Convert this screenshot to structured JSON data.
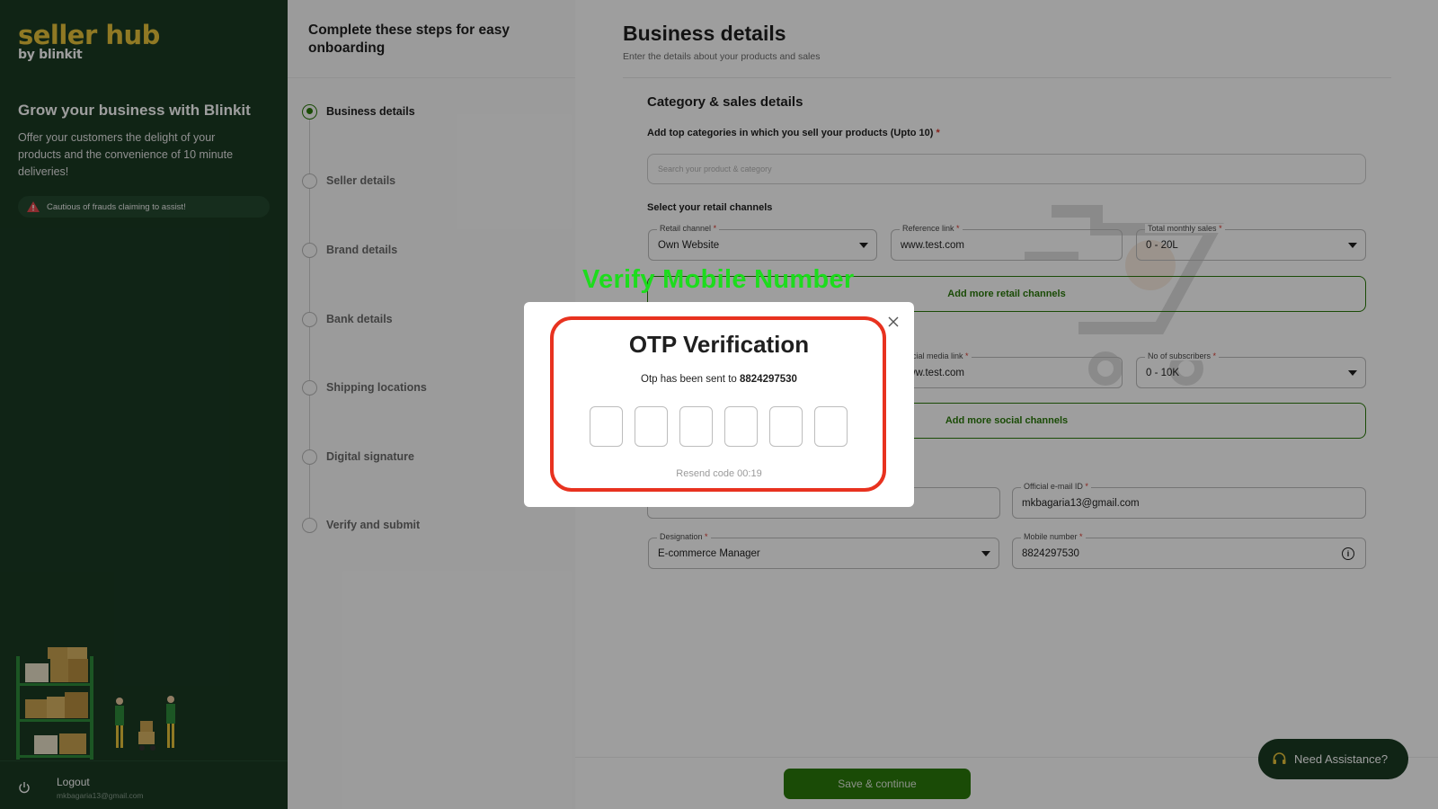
{
  "sidebar": {
    "logo_main": "seller hub",
    "logo_sub": "by blinkit",
    "headline": "Grow your business with Blinkit",
    "description": "Offer your customers the delight of your products and the convenience of 10 minute deliveries!",
    "fraud_warning": "Cautious of frauds claiming to assist!",
    "logout_label": "Logout",
    "logout_email": "mkbagaria13@gmail.com"
  },
  "steps": {
    "title": "Complete these steps for easy onboarding",
    "items": [
      {
        "label": "Business details",
        "active": true
      },
      {
        "label": "Seller details",
        "active": false
      },
      {
        "label": "Brand details",
        "active": false
      },
      {
        "label": "Bank details",
        "active": false
      },
      {
        "label": "Shipping locations",
        "active": false
      },
      {
        "label": "Digital signature",
        "active": false
      },
      {
        "label": "Verify and submit",
        "active": false
      }
    ]
  },
  "main": {
    "title": "Business details",
    "subtitle": "Enter the details about your products and sales",
    "section_title": "Category & sales details",
    "categories_label": "Add top categories in which you sell your products (Upto 10)",
    "categories_placeholder": "Search your product & category",
    "retail_label": "Select your retail channels",
    "retail_channel": {
      "legend": "Retail channel",
      "value": "Own Website"
    },
    "reference_link": {
      "legend": "Reference link",
      "value": "www.test.com"
    },
    "monthly_sales": {
      "legend": "Total monthly sales",
      "value": "0 - 20L"
    },
    "add_retail": "Add more retail channels",
    "social_link": {
      "legend": "Social media link",
      "value": "www.test.com"
    },
    "subscribers": {
      "legend": "No of subscribers",
      "value": "0 - 10K"
    },
    "add_social": "Add more social channels",
    "email": {
      "legend": "Official e-mail ID",
      "value": "mkbagaria13@gmail.com"
    },
    "designation": {
      "legend": "Designation",
      "value": "E-commerce Manager"
    },
    "mobile": {
      "legend": "Mobile number",
      "value": "8824297530"
    },
    "required_mark": "*",
    "save_label": "Save & continue",
    "assist_label": "Need Assistance?"
  },
  "annotation": "Verify Mobile Number",
  "modal": {
    "title": "OTP Verification",
    "message_prefix": "Otp has been sent to",
    "phone": "8824297530",
    "otp_digits": [
      "",
      "",
      "",
      "",
      "",
      ""
    ],
    "resend": "Resend code 00:19"
  },
  "colors": {
    "sidebar_bg": "#1a3a23",
    "brand_yellow": "#e8c33a",
    "primary_green": "#2b7a0b",
    "annotation_green": "#1ddc1d",
    "highlight_red": "#e8321f"
  }
}
